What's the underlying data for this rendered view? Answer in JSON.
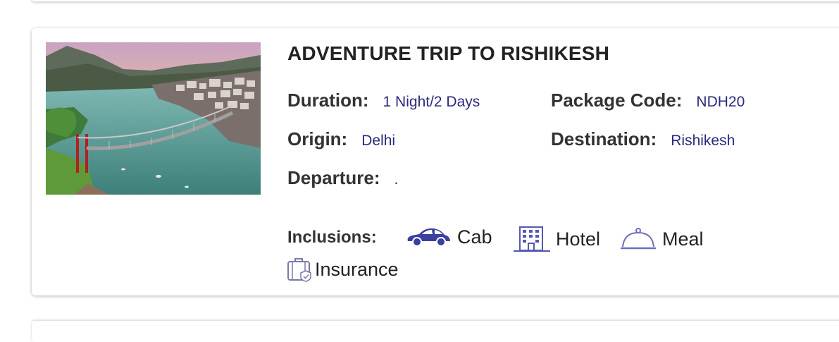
{
  "package": {
    "title": "ADVENTURE TRIP TO RISHIKESH",
    "image_alt": "Rishikesh river and suspension bridge",
    "duration_label": "Duration:",
    "duration_value": "1 Night/2 Days",
    "package_code_label": "Package Code:",
    "package_code_value": "NDH20",
    "origin_label": "Origin:",
    "origin_value": "Delhi",
    "destination_label": "Destination:",
    "destination_value": "Rishikesh",
    "departure_label": "Departure:",
    "departure_value": ".",
    "inclusions_label": "Inclusions:",
    "inclusions": [
      {
        "label": "Cab",
        "icon": "car-icon"
      },
      {
        "label": "Hotel",
        "icon": "hotel-icon"
      },
      {
        "label": "Meal",
        "icon": "meal-cloche-icon"
      },
      {
        "label": "Insurance",
        "icon": "insurance-bag-icon"
      }
    ]
  },
  "colors": {
    "value_text": "#2a2a7f",
    "icon_accent": "#3b3f9e",
    "icon_light": "#6f6fb8"
  }
}
